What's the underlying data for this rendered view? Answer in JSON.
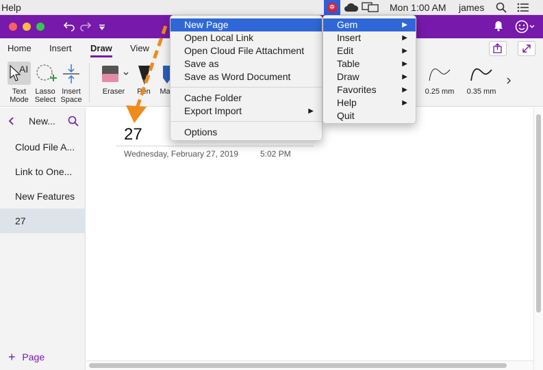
{
  "menubar": {
    "help": "Help",
    "clock": "Mon 1:00 AM",
    "user": "james"
  },
  "tabs": [
    {
      "label": "Home"
    },
    {
      "label": "Insert"
    },
    {
      "label": "Draw"
    },
    {
      "label": "View"
    }
  ],
  "ribbon": {
    "text_mode": "Text\nMode",
    "lasso_select": "Lasso\nSelect",
    "insert_space": "Insert\nSpace",
    "eraser": "Eraser",
    "pen": "Pen",
    "marker": "Ma",
    "thickness": [
      "0.25 mm",
      "0.35 mm"
    ]
  },
  "nav": {
    "section": "New...",
    "pages": [
      "Cloud File A...",
      "Link to One...",
      "New Features",
      "27"
    ],
    "add_page": "Page"
  },
  "page": {
    "title": "27",
    "date": "Wednesday, February 27, 2019",
    "time": "5:02 PM"
  },
  "gem_menu": {
    "items": [
      "New Page",
      "Open Local Link",
      "Open Cloud File Attachment",
      "Save as",
      "Save as Word Document",
      "Cache Folder",
      "Export Import",
      "Options"
    ]
  },
  "gem_submenu": {
    "items": [
      "Gem",
      "Insert",
      "Edit",
      "Table",
      "Draw",
      "Favorites",
      "Help",
      "Quit"
    ]
  },
  "colors": {
    "accent": "#7719aa",
    "highlight": "#2f68d6",
    "annotation": "#f08a1c"
  }
}
